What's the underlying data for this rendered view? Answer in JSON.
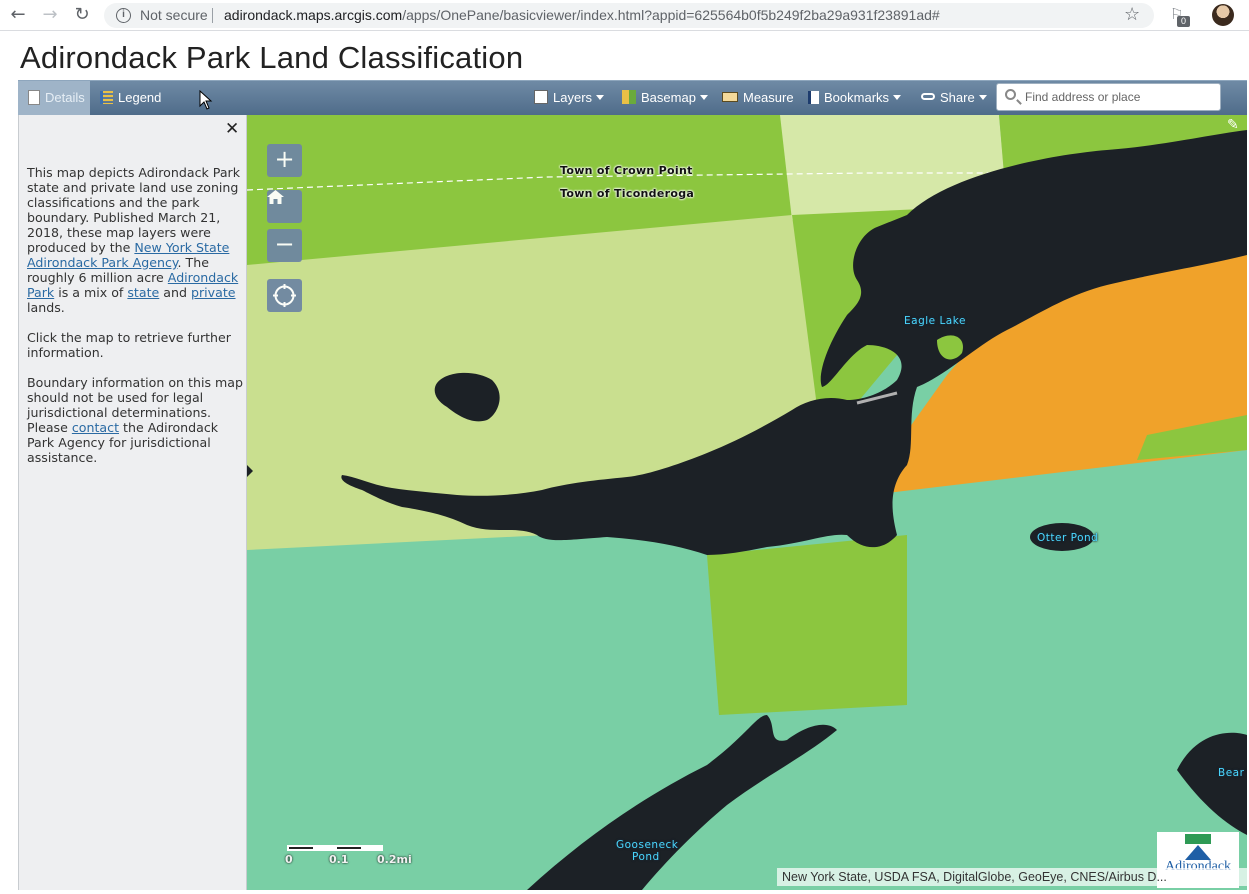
{
  "browser": {
    "back_icon": "arrow-left-icon",
    "forward_icon": "arrow-right-icon",
    "reload_icon": "reload-icon",
    "security_label": "Not secure",
    "url_domain": "adirondack.maps.arcgis.com",
    "url_rest": "/apps/OnePane/basicviewer/index.html?appid=625564b0f5b249f2ba29a931f23891ad#",
    "extension_badge": "0"
  },
  "app": {
    "title": "Adirondack Park Land Classification"
  },
  "toolbar": {
    "details_label": "Details",
    "legend_label": "Legend",
    "layers_label": "Layers",
    "basemap_label": "Basemap",
    "measure_label": "Measure",
    "bookmarks_label": "Bookmarks",
    "share_label": "Share",
    "search_placeholder": "Find address or place"
  },
  "panel": {
    "close_glyph": "✕",
    "p1_a": "This map depicts Adirondack Park state and private land use zoning classifications and the park boundary. Published March 21, 2018, these map layers were produced by the ",
    "p1_link1": "New York State Adirondack Park Agency",
    "p1_b": ". The roughly 6 million acre ",
    "p1_link2": "Adirondack Park",
    "p1_c": " is a mix of ",
    "p1_link3": "state",
    "p1_d": " and ",
    "p1_link4": "private",
    "p1_e": " lands.",
    "p2": "Click the map to retrieve further information.",
    "p3_a": "Boundary information on this map should not be used for legal jurisdictional determinations. Please ",
    "p3_link": "contact",
    "p3_b": " the Adirondack Park Agency for jurisdictional assistance."
  },
  "map": {
    "zoom_in_glyph": "+",
    "zoom_out_glyph": "−",
    "labels": {
      "town_crown_point": "Town of Crown Point",
      "town_ticonderoga": "Town of Ticonderoga",
      "eagle_lake": "Eagle Lake",
      "otter_pond": "Otter Pond",
      "gooseneck_1": "Gooseneck",
      "gooseneck_2": "Pond",
      "bear": "Bear"
    },
    "scale": {
      "l0": "0",
      "l1": "0.1",
      "l2": "0.2mi"
    },
    "attribution": "New York State, USDA FSA, DigitalGlobe, GeoEye, CNES/Airbus D...",
    "logo_text": "Adirondack",
    "colors": {
      "intensive_green": "#8cc63f",
      "pale_green": "#c9df8f",
      "teal": "#79cfa5",
      "orange": "#f0a22a",
      "water": "#1c2126"
    }
  }
}
